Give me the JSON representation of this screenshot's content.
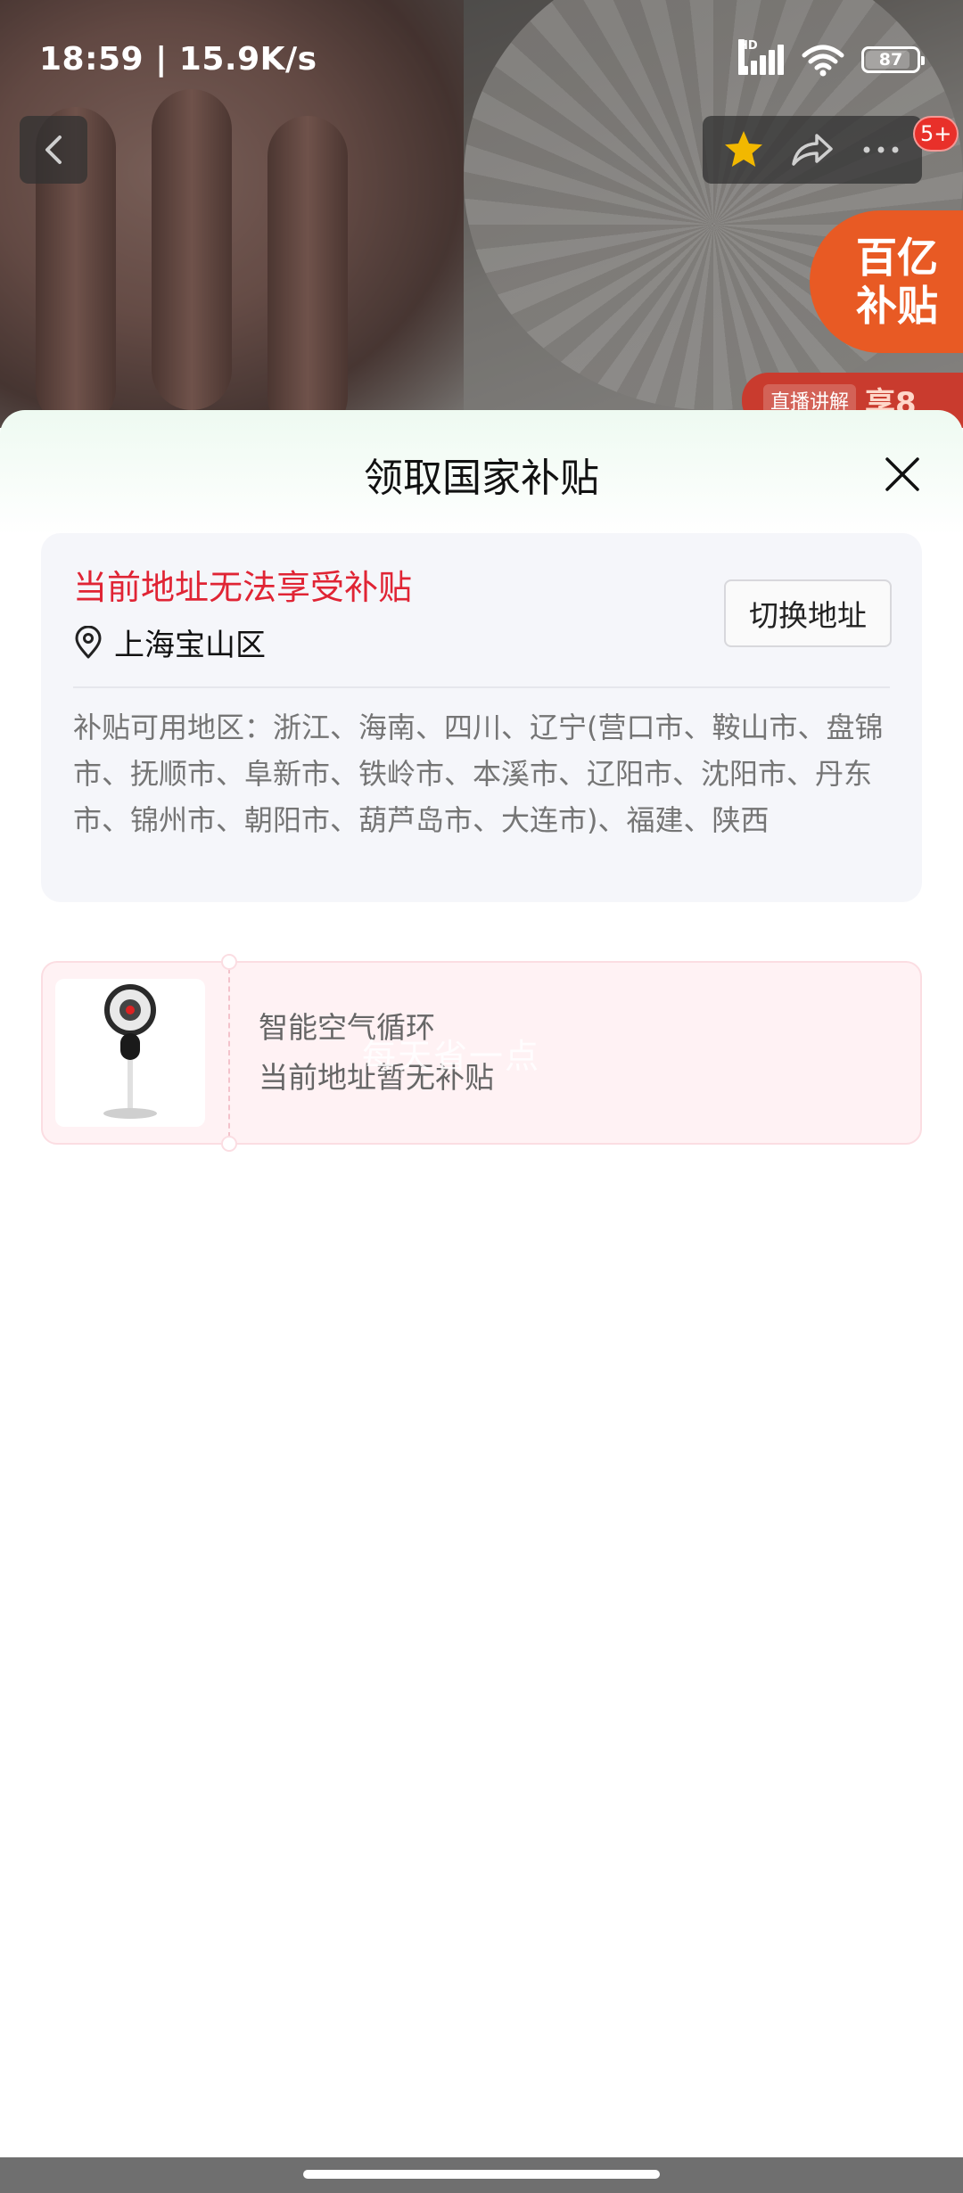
{
  "status_bar": {
    "time_speed": "18:59 | 15.9K/s",
    "hd_label": "HD",
    "battery": "87",
    "battery_level": 0.87
  },
  "header": {
    "cart_badge": "5+"
  },
  "promo": {
    "line1": "百亿",
    "line2": "补贴",
    "live_tag": "直播讲解",
    "live_text": "享8"
  },
  "sheet": {
    "title": "领取国家补贴",
    "address_card": {
      "warning": "当前地址无法享受补贴",
      "location": "上海宝山区",
      "switch_button": "切换地址",
      "regions": "补贴可用地区：浙江、海南、四川、辽宁(营口市、鞍山市、盘锦市、抚顺市、阜新市、铁岭市、本溪市、辽阳市、沈阳市、丹东市、锦州市、朝阳市、葫芦岛市、大连市)、福建、陕西"
    },
    "product": {
      "name": "智能空气循环",
      "status": "当前地址暂无补贴",
      "watermark": "每天省一点"
    }
  },
  "colors": {
    "warning_red": "#e02434",
    "card_bg": "#f5f6fa",
    "product_card_bg": "#fff2f4",
    "star_gold": "#f2b800",
    "promo_orange": "#e85a24"
  }
}
